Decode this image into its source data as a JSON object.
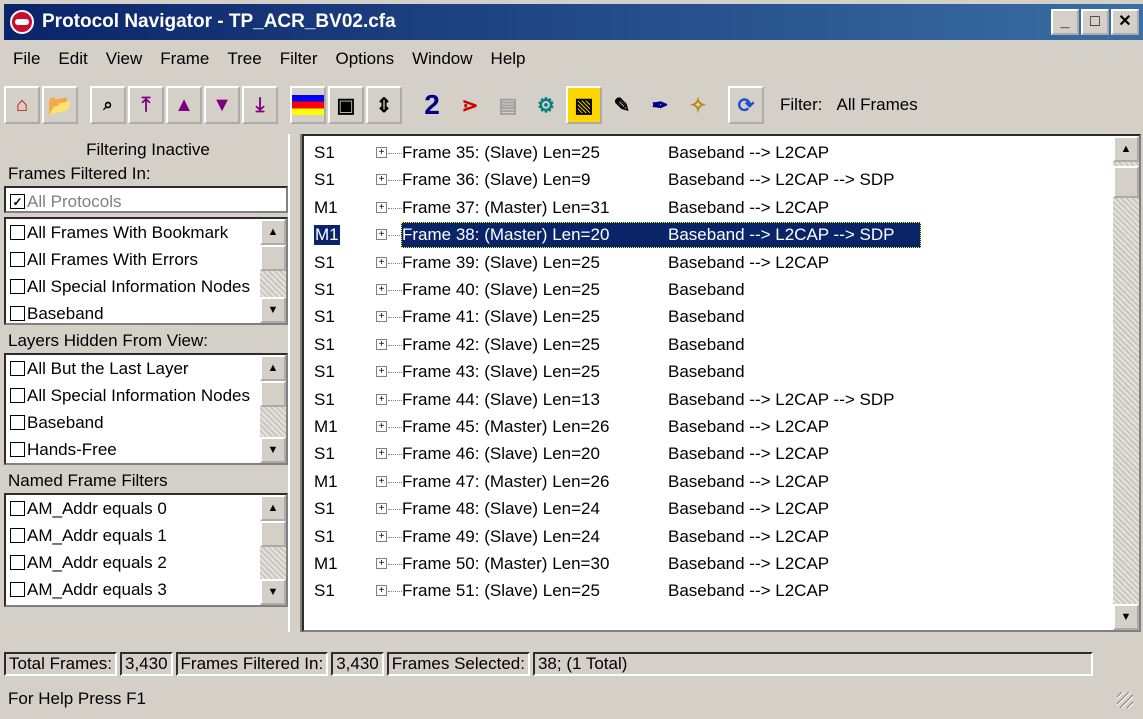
{
  "window": {
    "title": "Protocol Navigator - TP_ACR_BV02.cfa",
    "app_icon": "protocol-navigator-icon",
    "controls": [
      "minimize",
      "maximize",
      "close"
    ]
  },
  "menu": [
    "File",
    "Edit",
    "View",
    "Frame",
    "Tree",
    "Filter",
    "Options",
    "Window",
    "Help"
  ],
  "toolbar": {
    "buttons": [
      "home-icon",
      "open-folder-icon",
      "find-icon",
      "go-first-icon",
      "go-up-icon",
      "go-down-icon",
      "go-last-icon",
      "stack-icon",
      "save-icon",
      "expand-collapse-icon",
      "number-two-icon",
      "decode-icon",
      "protocol-icon",
      "gear-filter-icon",
      "filter-box-icon",
      "notepad-icon",
      "pen-icon",
      "wand-icon",
      "refresh-icon"
    ],
    "filter_label": "Filter:",
    "filter_value": "All Frames"
  },
  "left": {
    "filtering_status": "Filtering Inactive",
    "frames_filtered_in_label": "Frames Filtered In:",
    "all_protocols": "All Protocols",
    "frames_filtered_items": [
      "All Frames With Bookmark",
      "All Frames With Errors",
      "All Special Information Nodes",
      "Baseband"
    ],
    "layers_hidden_label": "Layers Hidden From View:",
    "layers_hidden_items": [
      "All But the Last Layer",
      "All Special Information Nodes",
      "Baseband",
      "Hands-Free"
    ],
    "named_filters_label": "Named Frame Filters",
    "named_filters_items": [
      "AM_Addr equals 0",
      "AM_Addr equals 1",
      "AM_Addr equals 2",
      "AM_Addr equals 3"
    ]
  },
  "frames": [
    {
      "src": "S1",
      "frame": "Frame 35: (Slave) Len=25",
      "proto": "Baseband --> L2CAP"
    },
    {
      "src": "S1",
      "frame": "Frame 36: (Slave) Len=9",
      "proto": "Baseband --> L2CAP --> SDP"
    },
    {
      "src": "M1",
      "frame": "Frame 37: (Master) Len=31",
      "proto": "Baseband --> L2CAP"
    },
    {
      "src": "M1",
      "frame": "Frame 38: (Master) Len=20",
      "proto": "Baseband --> L2CAP --> SDP",
      "selected": true
    },
    {
      "src": "S1",
      "frame": "Frame 39: (Slave) Len=25",
      "proto": "Baseband --> L2CAP"
    },
    {
      "src": "S1",
      "frame": "Frame 40: (Slave) Len=25",
      "proto": "Baseband"
    },
    {
      "src": "S1",
      "frame": "Frame 41: (Slave) Len=25",
      "proto": "Baseband"
    },
    {
      "src": "S1",
      "frame": "Frame 42: (Slave) Len=25",
      "proto": "Baseband"
    },
    {
      "src": "S1",
      "frame": "Frame 43: (Slave) Len=25",
      "proto": "Baseband"
    },
    {
      "src": "S1",
      "frame": "Frame 44: (Slave) Len=13",
      "proto": "Baseband --> L2CAP --> SDP"
    },
    {
      "src": "M1",
      "frame": "Frame 45: (Master) Len=26",
      "proto": "Baseband --> L2CAP"
    },
    {
      "src": "S1",
      "frame": "Frame 46: (Slave) Len=20",
      "proto": "Baseband --> L2CAP"
    },
    {
      "src": "M1",
      "frame": "Frame 47: (Master) Len=26",
      "proto": "Baseband --> L2CAP"
    },
    {
      "src": "S1",
      "frame": "Frame 48: (Slave) Len=24",
      "proto": "Baseband --> L2CAP"
    },
    {
      "src": "S1",
      "frame": "Frame 49: (Slave) Len=24",
      "proto": "Baseband --> L2CAP"
    },
    {
      "src": "M1",
      "frame": "Frame 50: (Master) Len=30",
      "proto": "Baseband --> L2CAP"
    },
    {
      "src": "S1",
      "frame": "Frame 51: (Slave) Len=25",
      "proto": "Baseband --> L2CAP"
    }
  ],
  "status": {
    "total_label": "Total Frames:",
    "total_value": "3,430",
    "filtered_label": "Frames Filtered In:",
    "filtered_value": "3,430",
    "selected_label": "Frames Selected:",
    "selected_value": "38;  (1 Total)",
    "help": "For Help Press F1"
  },
  "colors": {
    "title_start": "#0a246a",
    "title_end": "#3a6ea5",
    "selection": "#0a246a",
    "face": "#d4d0c8"
  }
}
